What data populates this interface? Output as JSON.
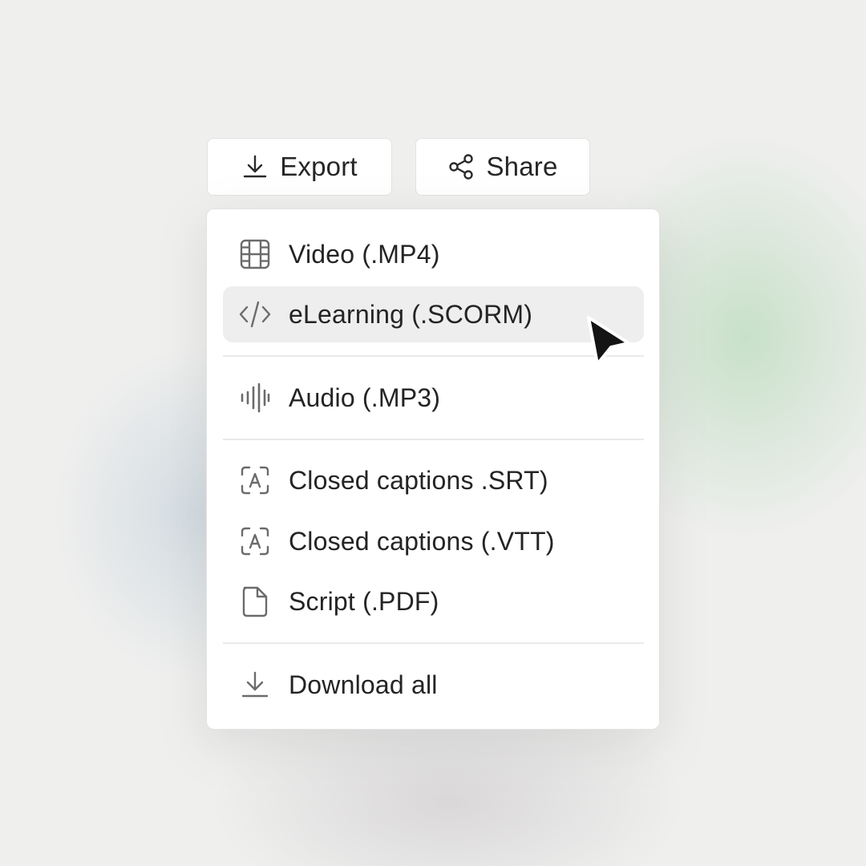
{
  "toolbar": {
    "export_label": "Export",
    "share_label": "Share"
  },
  "menu": {
    "items": [
      {
        "label": "Video (.MP4)",
        "icon": "film-icon"
      },
      {
        "label": "eLearning (.SCORM)",
        "icon": "code-icon",
        "state": "hovered"
      },
      {
        "label": "Audio (.MP3)",
        "icon": "waveform-icon"
      },
      {
        "label": "Closed captions .SRT)",
        "icon": "captions-icon"
      },
      {
        "label": "Closed captions (.VTT)",
        "icon": "captions-icon"
      },
      {
        "label": "Script (.PDF)",
        "icon": "document-icon"
      },
      {
        "label": "Download all",
        "icon": "download-icon"
      }
    ]
  },
  "colors": {
    "hover_background": "#eeeeee",
    "icon_color": "#6b6b6b",
    "text_color": "#242424"
  }
}
